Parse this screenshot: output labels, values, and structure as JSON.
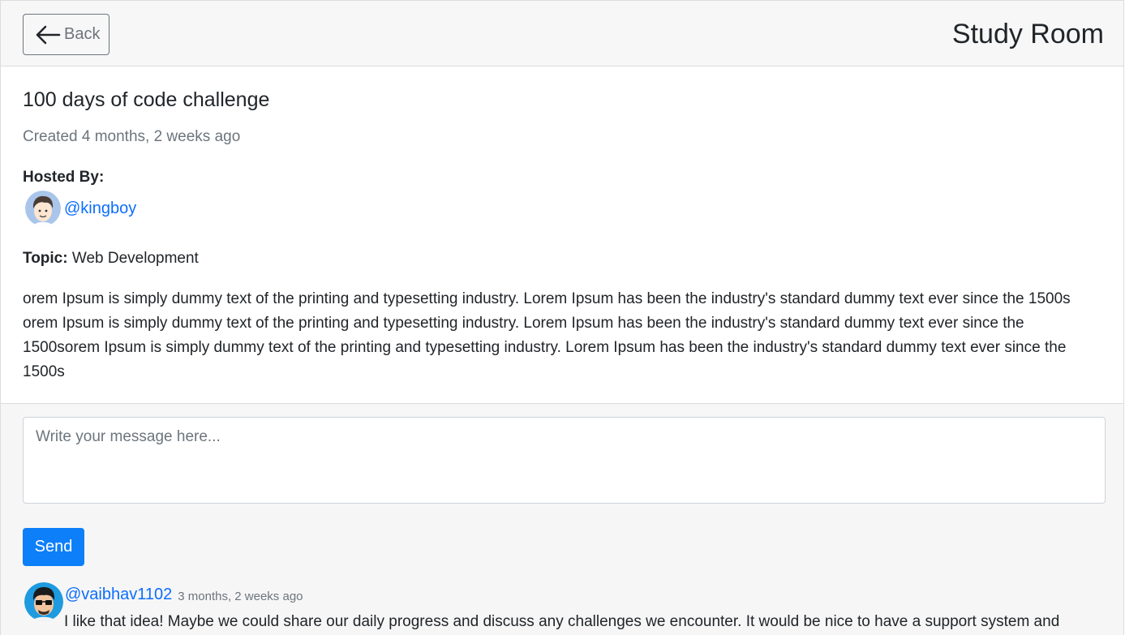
{
  "header": {
    "back_label": "Back",
    "title": "Study Room"
  },
  "room": {
    "name": "100 days of code challenge",
    "created": "Created 4 months, 2 weeks ago",
    "hosted_by_label": "Hosted By:",
    "host_username": "@kingboy",
    "topic_label": "Topic:",
    "topic_value": "Web Development",
    "description": "orem Ipsum is simply dummy text of the printing and typesetting industry. Lorem Ipsum has been the industry's standard dummy text ever since the 1500s orem Ipsum is simply dummy text of the printing and typesetting industry. Lorem Ipsum has been the industry's standard dummy text ever since the 1500sorem Ipsum is simply dummy text of the printing and typesetting industry. Lorem Ipsum has been the industry's standard dummy text ever since the 1500s"
  },
  "chat": {
    "input_placeholder": "Write your message here...",
    "send_label": "Send",
    "messages": [
      {
        "username": "@vaibhav1102",
        "time": "3 months, 2 weeks ago",
        "body": "I like that idea! Maybe we could share our daily progress and discuss any challenges we encounter. It would be nice to have a support system and"
      }
    ]
  },
  "colors": {
    "link": "#0d6efd",
    "primary_button": "#0d7ff8",
    "muted_text": "#6c757d",
    "header_bg": "#f7f7f7",
    "chat_bg": "#f6f6f6"
  },
  "icons": {
    "back": "arrow-left-icon",
    "host_avatar": "avatar-icon",
    "message_avatar": "avatar-icon"
  }
}
